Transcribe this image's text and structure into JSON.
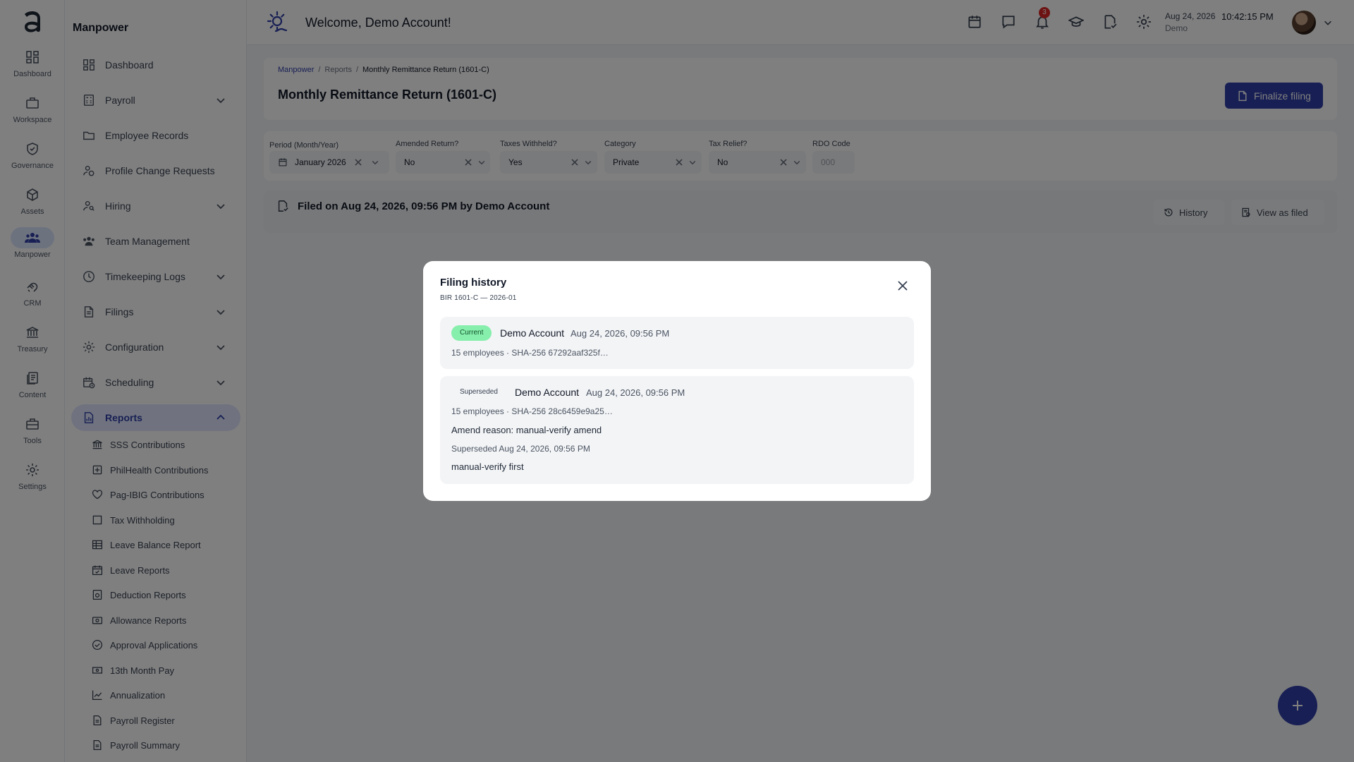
{
  "rail": {
    "items": [
      {
        "label": "Dashboard",
        "icon": "dashboard-icon"
      },
      {
        "label": "Workspace",
        "icon": "briefcase-icon"
      },
      {
        "label": "Governance",
        "icon": "shield-check-icon"
      },
      {
        "label": "Assets",
        "icon": "cube-icon"
      },
      {
        "label": "Manpower",
        "icon": "people-icon",
        "active": true
      },
      {
        "label": "CRM",
        "icon": "handshake-icon"
      },
      {
        "label": "Treasury",
        "icon": "bank-icon"
      },
      {
        "label": "Content",
        "icon": "documents-icon"
      },
      {
        "label": "Tools",
        "icon": "toolbox-icon"
      },
      {
        "label": "Settings",
        "icon": "gear-icon"
      }
    ]
  },
  "sidebar": {
    "title": "Manpower",
    "items": [
      {
        "label": "Dashboard",
        "icon": "dashboard-icon"
      },
      {
        "label": "Payroll",
        "icon": "calculator-icon",
        "chevron": "down"
      },
      {
        "label": "Employee Records",
        "icon": "folder-icon"
      },
      {
        "label": "Profile Change Requests",
        "icon": "user-refresh-icon"
      },
      {
        "label": "Hiring",
        "icon": "user-search-icon",
        "chevron": "down"
      },
      {
        "label": "Team Management",
        "icon": "team-icon"
      },
      {
        "label": "Timekeeping Logs",
        "icon": "clock-icon",
        "chevron": "down"
      },
      {
        "label": "Filings",
        "icon": "file-icon",
        "chevron": "down"
      },
      {
        "label": "Configuration",
        "icon": "gear-icon",
        "chevron": "down"
      },
      {
        "label": "Scheduling",
        "icon": "calendar-clock-icon",
        "chevron": "down"
      },
      {
        "label": "Reports",
        "icon": "report-icon",
        "chevron": "up",
        "active": true
      }
    ],
    "sub_items": [
      {
        "label": "SSS Contributions",
        "icon": "bank-icon"
      },
      {
        "label": "PhilHealth Contributions",
        "icon": "medical-plus-icon"
      },
      {
        "label": "Pag-IBIG Contributions",
        "icon": "heart-icon"
      },
      {
        "label": "Tax Withholding",
        "icon": "square-icon"
      },
      {
        "label": "Leave Balance Report",
        "icon": "table-icon"
      },
      {
        "label": "Leave Reports",
        "icon": "calendar-check-icon"
      },
      {
        "label": "Deduction Reports",
        "icon": "receipt-icon"
      },
      {
        "label": "Allowance Reports",
        "icon": "money-icon"
      },
      {
        "label": "Approval Applications",
        "icon": "check-circle-icon"
      },
      {
        "label": "13th Month Pay",
        "icon": "cash-icon"
      },
      {
        "label": "Annualization",
        "icon": "line-chart-icon"
      },
      {
        "label": "Payroll Register",
        "icon": "document-icon"
      },
      {
        "label": "Payroll Summary",
        "icon": "document-icon"
      }
    ]
  },
  "header": {
    "welcome": "Welcome, Demo Account!",
    "notification_count": "3",
    "date": "Aug 24, 2026",
    "time": "10:42:15 PM",
    "user": "Demo"
  },
  "page": {
    "breadcrumb": [
      "Manpower",
      "Reports",
      "Monthly Remittance Return (1601-C)"
    ],
    "title": "Monthly Remittance Return (1601-C)",
    "finalize_label": "Finalize filing",
    "filters": [
      {
        "label": "Period (Month/Year)",
        "value": "January 2026"
      },
      {
        "label": "Amended Return?",
        "value": "No"
      },
      {
        "label": "Taxes Withheld?",
        "value": "Yes"
      },
      {
        "label": "Category",
        "value": "Private"
      },
      {
        "label": "Tax Relief?",
        "value": "No"
      }
    ],
    "rdo": {
      "label": "RDO Code",
      "placeholder": "000"
    },
    "filed_text": "Filed on Aug 24, 2026, 09:56 PM by Demo Account",
    "history_label": "History",
    "view_as_filed_label": "View as filed"
  },
  "modal": {
    "title": "Filing history",
    "subtitle": "BIR 1601-C — 2026-01",
    "entries": [
      {
        "status": "Current",
        "name": "Demo Account",
        "date": "Aug 24, 2026, 09:56 PM",
        "meta": "15 employees · SHA-256 67292aaf325f…"
      },
      {
        "status": "Superseded",
        "name": "Demo Account",
        "date": "Aug 24, 2026, 09:56 PM",
        "meta": "15 employees · SHA-256 28c6459e9a25…",
        "amend_reason": "Amend reason: manual-verify amend",
        "superseded_at": "Superseded Aug 24, 2026, 09:56 PM",
        "note": "manual-verify first"
      }
    ]
  },
  "colors": {
    "accent": "#2f3ea8",
    "current_pill": "#86efac",
    "badge": "#dc2626"
  }
}
